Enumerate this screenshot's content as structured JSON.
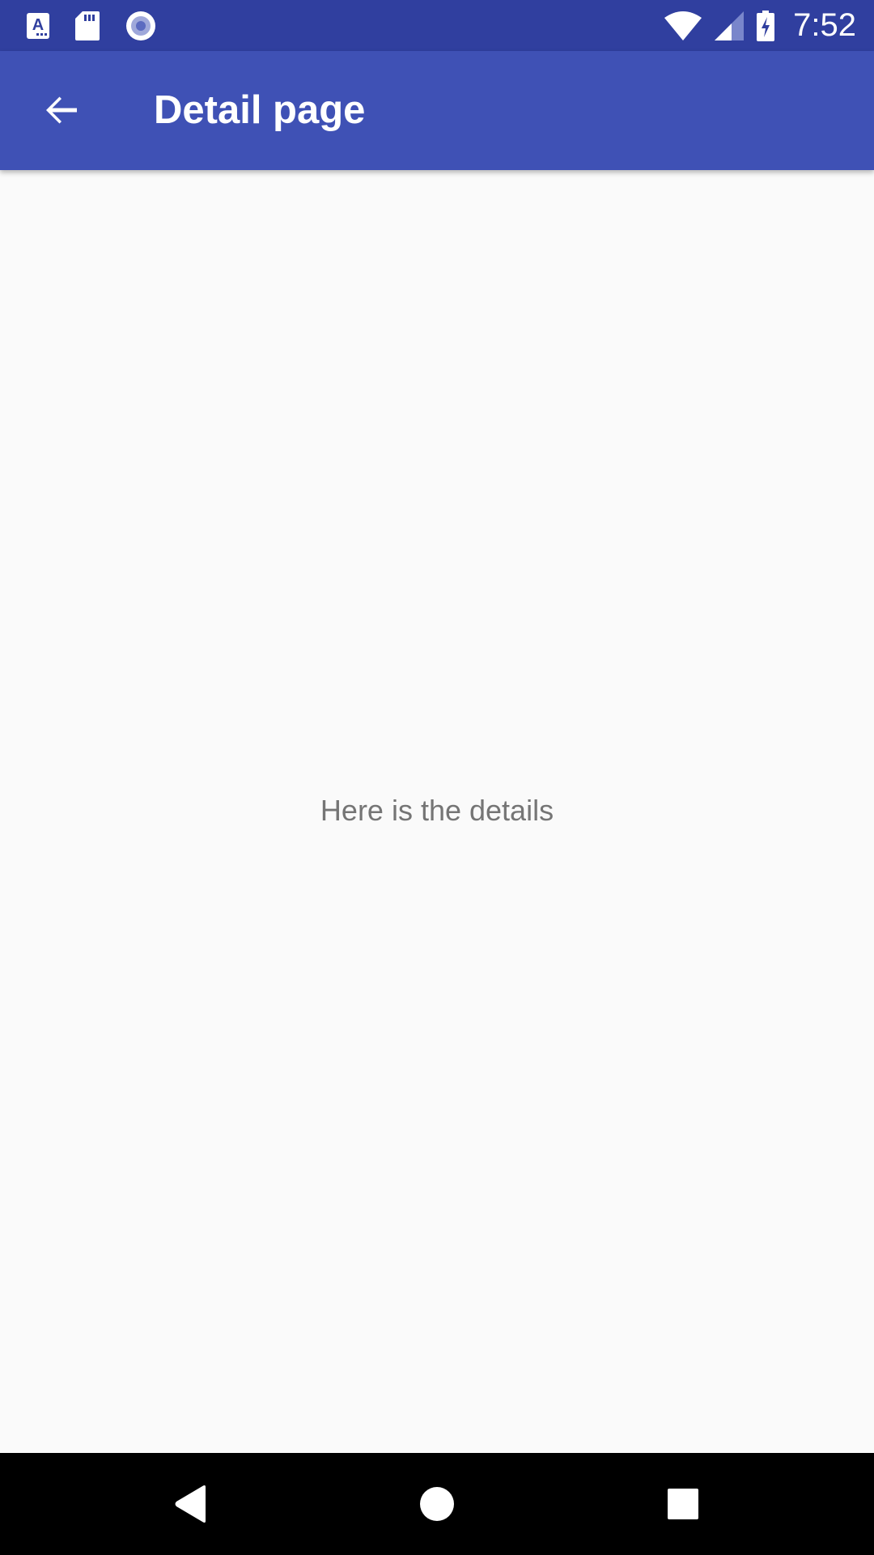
{
  "status_bar": {
    "time": "7:52",
    "left_icons": [
      "font-a-icon",
      "sd-card-icon",
      "record-icon"
    ],
    "right_icons": [
      "wifi-icon",
      "cell-signal-icon",
      "battery-charging-icon"
    ],
    "background": "#303f9f"
  },
  "app_bar": {
    "title": "Detail page",
    "back_icon": "arrow-back-icon",
    "background": "#3f51b5"
  },
  "content": {
    "message": "Here is the details"
  },
  "nav_bar": {
    "buttons": [
      "nav-back-icon",
      "nav-home-icon",
      "nav-recents-icon"
    ]
  }
}
